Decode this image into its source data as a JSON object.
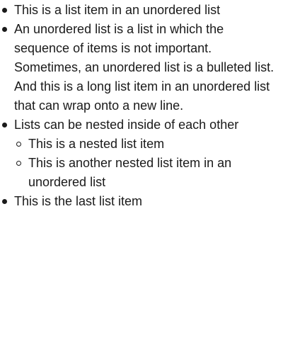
{
  "list": {
    "items": [
      {
        "text": "This is a list item in an unordered list"
      },
      {
        "text": "An unordered list is a list in which the sequence of items is not important. Sometimes, an unordered list is a bulleted list. And this is a long list item in an unordered list that can wrap onto a new line."
      },
      {
        "text": "Lists can be nested inside of each other",
        "children": [
          {
            "text": "This is a nested list item"
          },
          {
            "text": "This is another nested list item in an unordered list"
          }
        ]
      },
      {
        "text": "This is the last list item"
      }
    ]
  }
}
